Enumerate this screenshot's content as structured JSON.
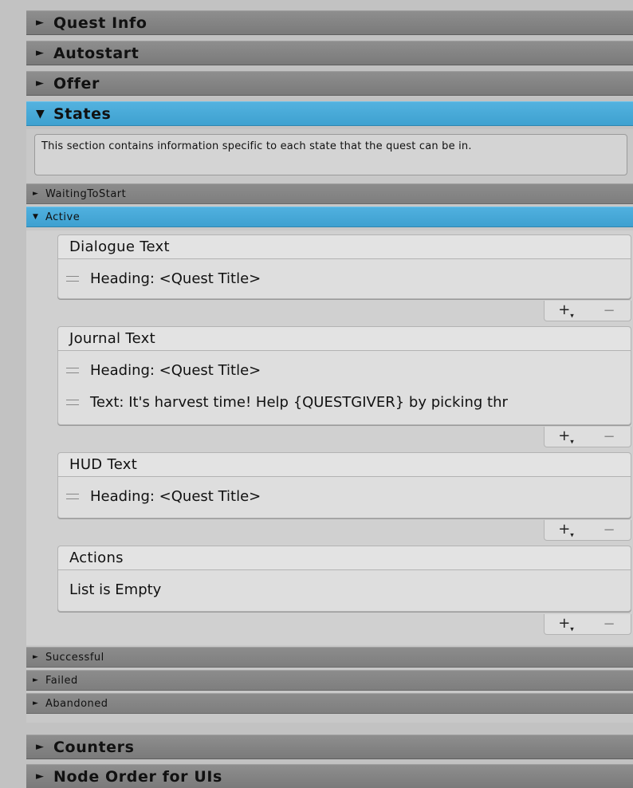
{
  "foldouts": {
    "quest_info": "Quest Info",
    "autostart": "Autostart",
    "offer": "Offer",
    "states": "States",
    "counters": "Counters",
    "node_order": "Node Order for UIs"
  },
  "arrows": {
    "collapsed": "►",
    "expanded": "▼"
  },
  "states": {
    "help_text": "This section contains information specific to each state that the quest can be in.",
    "substates": {
      "waiting": "WaitingToStart",
      "active": "Active",
      "successful": "Successful",
      "failed": "Failed",
      "abandoned": "Abandoned"
    }
  },
  "active_state": {
    "dialogue": {
      "title": "Dialogue Text",
      "items": [
        "Heading: <Quest Title>"
      ]
    },
    "journal": {
      "title": "Journal Text",
      "items": [
        "Heading: <Quest Title>",
        "Text: It's harvest time! Help {QUESTGIVER} by picking thr"
      ]
    },
    "hud": {
      "title": "HUD Text",
      "items": [
        "Heading: <Quest Title>"
      ]
    },
    "actions": {
      "title": "Actions",
      "empty_text": "List is Empty"
    }
  },
  "list_buttons": {
    "add": "+",
    "add_dropdown": "▾",
    "remove": "−"
  },
  "colors": {
    "accent": "#45a7d6",
    "header_gray": "#858585",
    "panel": "#d0d0d0"
  }
}
